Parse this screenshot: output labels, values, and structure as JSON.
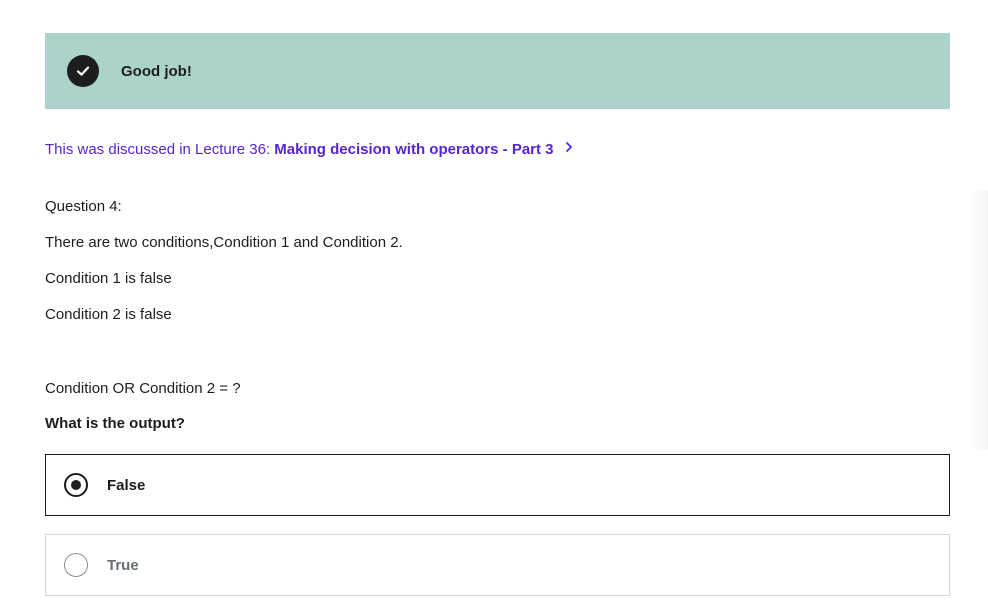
{
  "banner": {
    "message": "Good job!",
    "icon": "check-circle-icon"
  },
  "lecture_ref": {
    "prefix": "This was discussed in Lecture 36: ",
    "link_text": "Making decision with operators - Part 3",
    "chevron_icon": "chevron-right-icon"
  },
  "question": {
    "number_label": "Question 4:",
    "lines": [
      "There are two conditions,Condition 1 and Condition 2.",
      "Condition 1 is false",
      "Condition 2 is false"
    ],
    "expression": "Condition OR Condition 2 = ?",
    "prompt": "What is the output?"
  },
  "options": [
    {
      "label": "False",
      "selected": true
    },
    {
      "label": "True",
      "selected": false
    }
  ],
  "colors": {
    "banner_bg": "#acd2cc",
    "link": "#5624d0",
    "text": "#1c1d1f",
    "muted": "#6a6f73"
  }
}
